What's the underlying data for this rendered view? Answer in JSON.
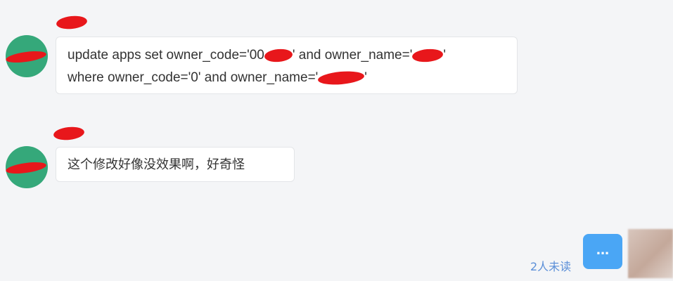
{
  "colors": {
    "background": "#f4f5f7",
    "bubble": "#ffffff",
    "avatar": "#35a87a",
    "redaction": "#e8171b",
    "accent": "#4aa6f5",
    "read_status": "#5b8fd8"
  },
  "messages": [
    {
      "line1_before": "update  apps  set owner_code='00",
      "line1_middle": "' and owner_name='",
      "line1_after": "'",
      "line2_before": "where owner_code='0' and owner_name='",
      "line2_after": "'"
    },
    {
      "text": "这个修改好像没效果啊，好奇怪"
    }
  ],
  "footer": {
    "read_status": "2人未读",
    "more_label": "..."
  }
}
